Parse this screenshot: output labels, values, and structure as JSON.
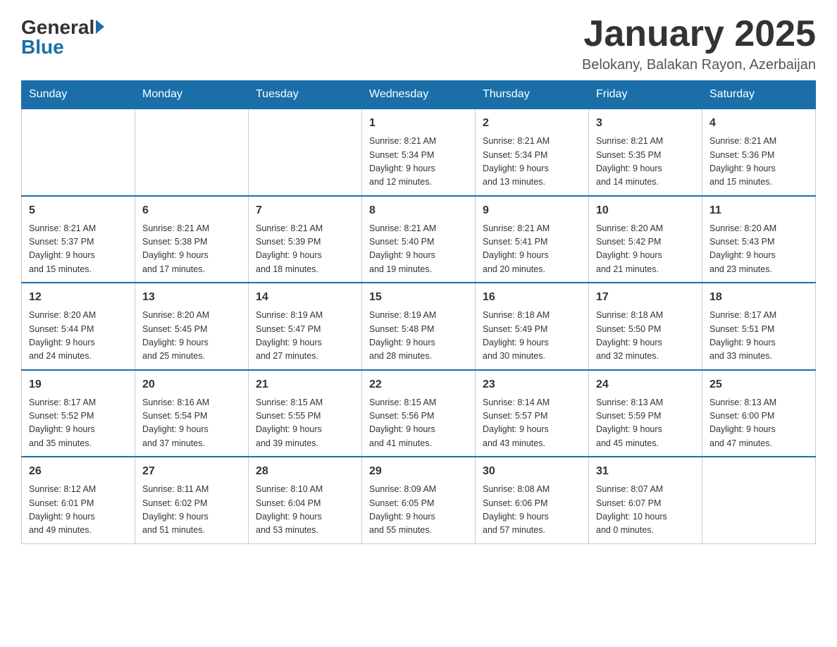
{
  "logo": {
    "general": "General",
    "blue": "Blue"
  },
  "title": "January 2025",
  "location": "Belokany, Balakan Rayon, Azerbaijan",
  "headers": [
    "Sunday",
    "Monday",
    "Tuesday",
    "Wednesday",
    "Thursday",
    "Friday",
    "Saturday"
  ],
  "weeks": [
    [
      {
        "day": "",
        "info": ""
      },
      {
        "day": "",
        "info": ""
      },
      {
        "day": "",
        "info": ""
      },
      {
        "day": "1",
        "info": "Sunrise: 8:21 AM\nSunset: 5:34 PM\nDaylight: 9 hours\nand 12 minutes."
      },
      {
        "day": "2",
        "info": "Sunrise: 8:21 AM\nSunset: 5:34 PM\nDaylight: 9 hours\nand 13 minutes."
      },
      {
        "day": "3",
        "info": "Sunrise: 8:21 AM\nSunset: 5:35 PM\nDaylight: 9 hours\nand 14 minutes."
      },
      {
        "day": "4",
        "info": "Sunrise: 8:21 AM\nSunset: 5:36 PM\nDaylight: 9 hours\nand 15 minutes."
      }
    ],
    [
      {
        "day": "5",
        "info": "Sunrise: 8:21 AM\nSunset: 5:37 PM\nDaylight: 9 hours\nand 15 minutes."
      },
      {
        "day": "6",
        "info": "Sunrise: 8:21 AM\nSunset: 5:38 PM\nDaylight: 9 hours\nand 17 minutes."
      },
      {
        "day": "7",
        "info": "Sunrise: 8:21 AM\nSunset: 5:39 PM\nDaylight: 9 hours\nand 18 minutes."
      },
      {
        "day": "8",
        "info": "Sunrise: 8:21 AM\nSunset: 5:40 PM\nDaylight: 9 hours\nand 19 minutes."
      },
      {
        "day": "9",
        "info": "Sunrise: 8:21 AM\nSunset: 5:41 PM\nDaylight: 9 hours\nand 20 minutes."
      },
      {
        "day": "10",
        "info": "Sunrise: 8:20 AM\nSunset: 5:42 PM\nDaylight: 9 hours\nand 21 minutes."
      },
      {
        "day": "11",
        "info": "Sunrise: 8:20 AM\nSunset: 5:43 PM\nDaylight: 9 hours\nand 23 minutes."
      }
    ],
    [
      {
        "day": "12",
        "info": "Sunrise: 8:20 AM\nSunset: 5:44 PM\nDaylight: 9 hours\nand 24 minutes."
      },
      {
        "day": "13",
        "info": "Sunrise: 8:20 AM\nSunset: 5:45 PM\nDaylight: 9 hours\nand 25 minutes."
      },
      {
        "day": "14",
        "info": "Sunrise: 8:19 AM\nSunset: 5:47 PM\nDaylight: 9 hours\nand 27 minutes."
      },
      {
        "day": "15",
        "info": "Sunrise: 8:19 AM\nSunset: 5:48 PM\nDaylight: 9 hours\nand 28 minutes."
      },
      {
        "day": "16",
        "info": "Sunrise: 8:18 AM\nSunset: 5:49 PM\nDaylight: 9 hours\nand 30 minutes."
      },
      {
        "day": "17",
        "info": "Sunrise: 8:18 AM\nSunset: 5:50 PM\nDaylight: 9 hours\nand 32 minutes."
      },
      {
        "day": "18",
        "info": "Sunrise: 8:17 AM\nSunset: 5:51 PM\nDaylight: 9 hours\nand 33 minutes."
      }
    ],
    [
      {
        "day": "19",
        "info": "Sunrise: 8:17 AM\nSunset: 5:52 PM\nDaylight: 9 hours\nand 35 minutes."
      },
      {
        "day": "20",
        "info": "Sunrise: 8:16 AM\nSunset: 5:54 PM\nDaylight: 9 hours\nand 37 minutes."
      },
      {
        "day": "21",
        "info": "Sunrise: 8:15 AM\nSunset: 5:55 PM\nDaylight: 9 hours\nand 39 minutes."
      },
      {
        "day": "22",
        "info": "Sunrise: 8:15 AM\nSunset: 5:56 PM\nDaylight: 9 hours\nand 41 minutes."
      },
      {
        "day": "23",
        "info": "Sunrise: 8:14 AM\nSunset: 5:57 PM\nDaylight: 9 hours\nand 43 minutes."
      },
      {
        "day": "24",
        "info": "Sunrise: 8:13 AM\nSunset: 5:59 PM\nDaylight: 9 hours\nand 45 minutes."
      },
      {
        "day": "25",
        "info": "Sunrise: 8:13 AM\nSunset: 6:00 PM\nDaylight: 9 hours\nand 47 minutes."
      }
    ],
    [
      {
        "day": "26",
        "info": "Sunrise: 8:12 AM\nSunset: 6:01 PM\nDaylight: 9 hours\nand 49 minutes."
      },
      {
        "day": "27",
        "info": "Sunrise: 8:11 AM\nSunset: 6:02 PM\nDaylight: 9 hours\nand 51 minutes."
      },
      {
        "day": "28",
        "info": "Sunrise: 8:10 AM\nSunset: 6:04 PM\nDaylight: 9 hours\nand 53 minutes."
      },
      {
        "day": "29",
        "info": "Sunrise: 8:09 AM\nSunset: 6:05 PM\nDaylight: 9 hours\nand 55 minutes."
      },
      {
        "day": "30",
        "info": "Sunrise: 8:08 AM\nSunset: 6:06 PM\nDaylight: 9 hours\nand 57 minutes."
      },
      {
        "day": "31",
        "info": "Sunrise: 8:07 AM\nSunset: 6:07 PM\nDaylight: 10 hours\nand 0 minutes."
      },
      {
        "day": "",
        "info": ""
      }
    ]
  ]
}
